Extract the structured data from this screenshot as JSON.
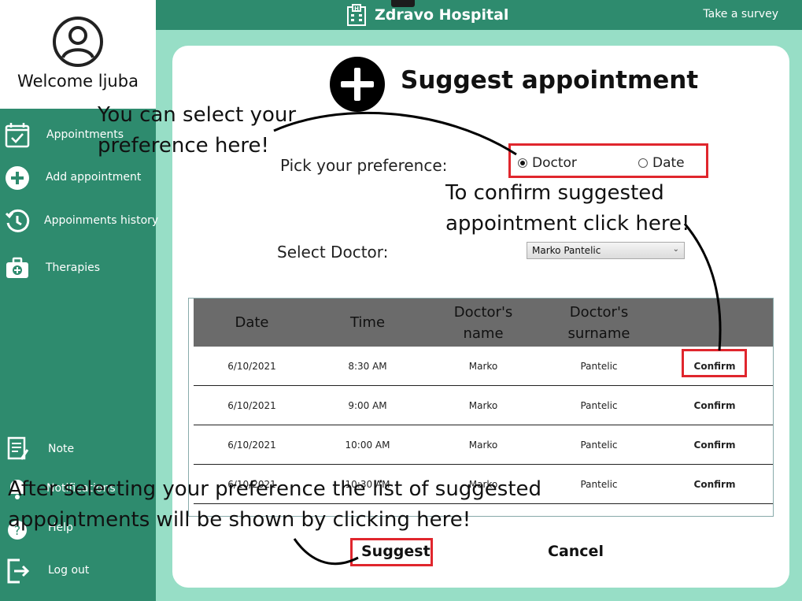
{
  "header": {
    "app_title": "Zdravo Hospital",
    "survey_link": "Take a survey"
  },
  "profile": {
    "welcome": "Welcome ljuba"
  },
  "sidebar": {
    "items": [
      {
        "label": "Appointments",
        "icon": "calendar-check-icon"
      },
      {
        "label": "Add appointment",
        "icon": "plus-circle-icon"
      },
      {
        "label": "Appoinments history",
        "icon": "history-icon"
      },
      {
        "label": "Therapies",
        "icon": "medical-kit-icon"
      },
      {
        "label": "Note",
        "icon": "note-icon"
      },
      {
        "label": "Notifications",
        "icon": "bell-icon"
      },
      {
        "label": "Help",
        "icon": "help-icon"
      },
      {
        "label": "Log out",
        "icon": "logout-icon"
      }
    ]
  },
  "main": {
    "title": "Suggest appointment",
    "preference_label": "Pick your preference:",
    "preference_options": [
      "Doctor",
      "Date"
    ],
    "preference_selected": "Doctor",
    "doctor_label": "Select Doctor:",
    "doctor_selected": "Marko Pantelic",
    "table": {
      "columns": [
        "Date",
        "Time",
        "Doctor's name",
        "Doctor's surname",
        ""
      ],
      "rows": [
        {
          "date": "6/10/2021",
          "time": "8:30 AM",
          "name": "Marko",
          "surname": "Pantelic",
          "action": "Confirm"
        },
        {
          "date": "6/10/2021",
          "time": "9:00 AM",
          "name": "Marko",
          "surname": "Pantelic",
          "action": "Confirm"
        },
        {
          "date": "6/10/2021",
          "time": "10:00 AM",
          "name": "Marko",
          "surname": "Pantelic",
          "action": "Confirm"
        },
        {
          "date": "6/10/2021",
          "time": "10:30 AM",
          "name": "Marko",
          "surname": "Pantelic",
          "action": "Confirm"
        }
      ]
    },
    "suggest_label": "Suggest",
    "cancel_label": "Cancel"
  },
  "annotations": {
    "preference_hint_1": "You can select your",
    "preference_hint_2": "preference here!",
    "confirm_hint_1": "To confirm suggested",
    "confirm_hint_2": "appointment click here!",
    "suggest_hint_1": "After selecting your preference the list of suggested",
    "suggest_hint_2": "appointments will be shown by clicking here!"
  },
  "colors": {
    "sidebar": "#2e8b6e",
    "background": "#97dec6",
    "highlight": "#e0262d",
    "table_header": "#6b6b6b"
  }
}
